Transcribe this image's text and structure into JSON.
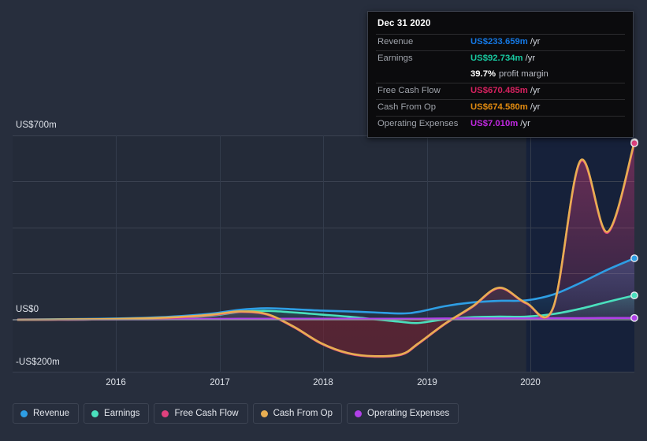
{
  "chart_data": {
    "type": "area",
    "title": "",
    "xlabel": "",
    "ylabel": "",
    "ylim": [
      -200,
      700
    ],
    "xlim": [
      2015.25,
      2021.0
    ],
    "grid": true,
    "legend_position": "bottom-left",
    "y_ticks": [
      {
        "value": 700,
        "label": "US$700m"
      },
      {
        "value": 0,
        "label": "US$0"
      },
      {
        "value": -200,
        "label": "-US$200m"
      }
    ],
    "x_ticks": [
      {
        "value": 2016,
        "label": "2016"
      },
      {
        "value": 2017,
        "label": "2017"
      },
      {
        "value": 2018,
        "label": "2018"
      },
      {
        "value": 2019,
        "label": "2019"
      },
      {
        "value": 2020,
        "label": "2020"
      }
    ],
    "units": "US$ millions per year",
    "x": [
      2015.3,
      2015.6,
      2015.9,
      2016.2,
      2016.5,
      2016.8,
      2017.1,
      2017.35,
      2017.6,
      2017.85,
      2018.1,
      2018.35,
      2018.6,
      2018.85,
      2019.0,
      2019.25,
      2019.5,
      2019.75,
      2020.0,
      2020.25,
      2020.5,
      2020.75,
      2021.0
    ],
    "series": [
      {
        "name": "Revenue",
        "color": "#2e9ee4",
        "values": [
          1,
          2,
          3,
          5,
          8,
          14,
          24,
          38,
          44,
          40,
          35,
          32,
          28,
          24,
          30,
          52,
          66,
          72,
          74,
          96,
          140,
          190,
          233.659
        ]
      },
      {
        "name": "Earnings",
        "color": "#4ae0bd",
        "values": [
          0,
          1,
          1,
          2,
          4,
          8,
          16,
          30,
          34,
          28,
          20,
          12,
          2,
          -8,
          -12,
          2,
          10,
          12,
          12,
          22,
          42,
          68,
          92.734
        ]
      },
      {
        "name": "Free Cash Flow",
        "color": "#e0417e",
        "values": [
          0,
          0,
          1,
          2,
          4,
          9,
          18,
          30,
          20,
          -28,
          -90,
          -128,
          -140,
          -132,
          -92,
          -16,
          48,
          120,
          62,
          46,
          600,
          330,
          670.485
        ]
      },
      {
        "name": "Cash From Op",
        "color": "#e8ae52",
        "values": [
          0,
          1,
          2,
          3,
          6,
          11,
          20,
          32,
          22,
          -26,
          -88,
          -126,
          -138,
          -130,
          -90,
          -14,
          50,
          122,
          64,
          48,
          604,
          334,
          674.58
        ]
      },
      {
        "name": "Operating Expenses",
        "color": "#b040e8",
        "values": [
          0,
          1,
          1,
          2,
          2,
          3,
          3,
          4,
          4,
          4,
          4,
          4,
          4,
          4,
          4,
          5,
          5,
          5,
          5,
          6,
          6,
          7,
          7.01
        ]
      }
    ],
    "highlight_band": {
      "from": 2020.0,
      "to": 2021.0,
      "label": "forecast-shading"
    },
    "endpoint_markers": [
      {
        "series": "Cash From Op",
        "value": 674.58
      },
      {
        "series": "Free Cash Flow",
        "value": 670.485
      },
      {
        "series": "Revenue",
        "value": 233.659
      },
      {
        "series": "Earnings",
        "value": 92.734
      },
      {
        "series": "Operating Expenses",
        "value": 7.01
      }
    ]
  },
  "tooltip": {
    "date": "Dec 31 2020",
    "rows": [
      {
        "key": "Revenue",
        "value": "US$233.659m",
        "unit": "/yr",
        "color": "#1478e4"
      },
      {
        "key": "Earnings",
        "value": "US$92.734m",
        "unit": "/yr",
        "color": "#18c9a0"
      },
      {
        "key": "Free Cash Flow",
        "value": "US$670.485m",
        "unit": "/yr",
        "color": "#d4215e"
      },
      {
        "key": "Cash From Op",
        "value": "US$674.580m",
        "unit": "/yr",
        "color": "#e08a10"
      },
      {
        "key": "Operating Expenses",
        "value": "US$7.010m",
        "unit": "/yr",
        "color": "#c028e0"
      }
    ],
    "margin_value": "39.7%",
    "margin_label": "profit margin"
  },
  "legend": {
    "items": [
      {
        "label": "Revenue",
        "color": "#2e9ee4"
      },
      {
        "label": "Earnings",
        "color": "#4ae0bd"
      },
      {
        "label": "Free Cash Flow",
        "color": "#e0417e"
      },
      {
        "label": "Cash From Op",
        "color": "#e8ae52"
      },
      {
        "label": "Operating Expenses",
        "color": "#b040e8"
      }
    ]
  },
  "colors": {
    "page_bg": "#272e3d",
    "plot_bg": "#242b39",
    "grid": "#3a4150",
    "zero_line": "#8e939c",
    "tooltip_bg": "#0b0b0d",
    "tooltip_border": "#3a3f4a",
    "text": "#dfe3ea"
  }
}
